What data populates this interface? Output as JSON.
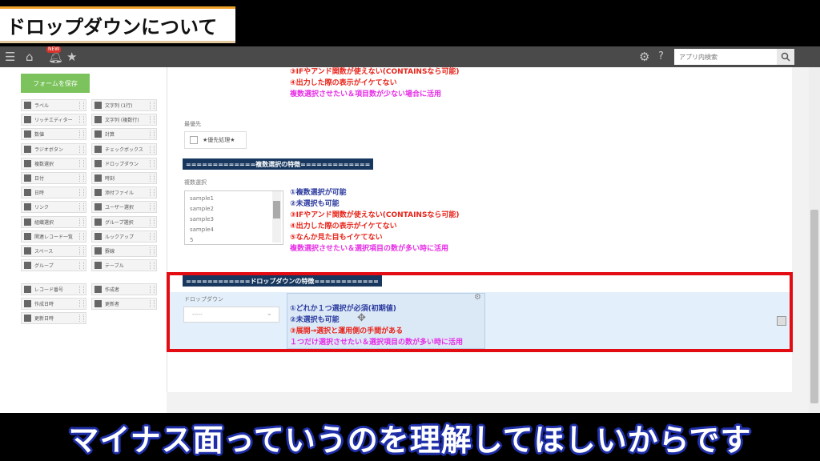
{
  "title": "ドロップダウンについて",
  "subtitle": "マイナス面っていうのを理解してほしいからです",
  "topbar": {
    "search_placeholder": "アプリ内検索",
    "badge": "NEW"
  },
  "sidebar": {
    "save_label": "フォームを保存",
    "fields": [
      [
        "ラベル",
        "文字列 (1行)"
      ],
      [
        "リッチエディター",
        "文字列 (複数行)"
      ],
      [
        "数値",
        "計算"
      ],
      [
        "ラジオボタン",
        "チェックボックス"
      ],
      [
        "複数選択",
        "ドロップダウン"
      ],
      [
        "日付",
        "時刻"
      ],
      [
        "日時",
        "添付ファイル"
      ],
      [
        "リンク",
        "ユーザー選択"
      ],
      [
        "組織選択",
        "グループ選択"
      ],
      [
        "関連レコード一覧",
        "ルックアップ"
      ],
      [
        "スペース",
        "罫線"
      ],
      [
        "グループ",
        "テーブル"
      ]
    ],
    "system_fields": [
      [
        "レコード番号",
        "作成者"
      ],
      [
        "作成日時",
        "更新者"
      ],
      [
        "更新日時",
        ""
      ]
    ]
  },
  "content": {
    "top_lines": [
      {
        "text": "③IFやアンド関数が使えない(CONTAINSなら可能)",
        "color": "red"
      },
      {
        "text": "④出力した際の表示がイケてない",
        "color": "red"
      },
      {
        "text": "複数選択させたい＆項目数が少ない場合に活用",
        "color": "magenta"
      }
    ],
    "priority_label": "最優先",
    "priority_option": "★優先処理★",
    "multi_header": "=============複数選択の特徴=============",
    "multi_label": "複数選択",
    "multi_options": [
      "sample1",
      "sample2",
      "sample3",
      "sample4",
      "5"
    ],
    "multi_lines": [
      {
        "text": "①複数選択が可能",
        "color": "blue"
      },
      {
        "text": "②未選択も可能",
        "color": "blue"
      },
      {
        "text": "③IFやアンド関数が使えない(CONTAINSなら可能)",
        "color": "red"
      },
      {
        "text": "④出力した際の表示がイケてない",
        "color": "red"
      },
      {
        "text": "⑤なんか見た目もイケてない",
        "color": "red"
      },
      {
        "text": "複数選択させたい＆選択項目の数が多い時に活用",
        "color": "magenta"
      }
    ],
    "dropdown_header": "============ドロップダウンの特徴============",
    "dropdown_label": "ドロップダウン",
    "dropdown_value": "-----",
    "dropdown_lines": [
      {
        "text": "①どれか１つ選択が必須(初期値)",
        "color": "blue"
      },
      {
        "text": "②未選択も可能",
        "color": "blue"
      },
      {
        "text": "③展開→選択と運用側の手間がある",
        "color": "red"
      },
      {
        "text": "１つだけ選択させたい＆選択項目の数が多い時に活用",
        "color": "magenta"
      }
    ]
  },
  "colors": {
    "highlight_frame": "#e30c13",
    "save_button": "#7cc35d",
    "header_bg": "#17375e"
  }
}
